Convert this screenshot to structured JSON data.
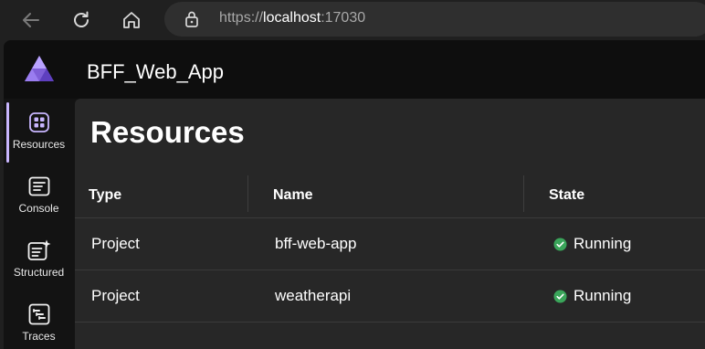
{
  "browser": {
    "url_scheme": "https://",
    "url_host": "localhost",
    "url_port": ":17030",
    "icons": [
      "back-icon",
      "refresh-icon",
      "home-icon",
      "lock-icon"
    ]
  },
  "app": {
    "title": "BFF_Web_App",
    "accent_color": "#c9b6ff",
    "running_color": "#3aa55a"
  },
  "sidebar": {
    "items": [
      {
        "label": "Resources",
        "icon": "resources-icon",
        "active": true
      },
      {
        "label": "Console",
        "icon": "console-icon"
      },
      {
        "label": "Structured",
        "icon": "structured-icon"
      },
      {
        "label": "Traces",
        "icon": "traces-icon"
      }
    ]
  },
  "main": {
    "title": "Resources",
    "columns": [
      "Type",
      "Name",
      "State"
    ],
    "rows": [
      {
        "type": "Project",
        "name": "bff-web-app",
        "state": "Running"
      },
      {
        "type": "Project",
        "name": "weatherapi",
        "state": "Running"
      }
    ]
  }
}
